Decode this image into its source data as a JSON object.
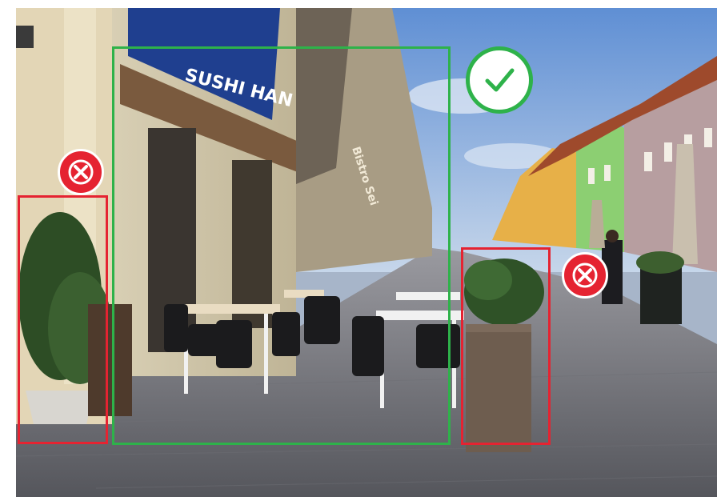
{
  "image": {
    "scene": "pedestrian cobblestone street with outdoor cafe terrace",
    "awning_text": "SUSHI HAN",
    "sign_text": "Bistro Sei"
  },
  "colors": {
    "accept": "#2eb24a",
    "reject": "#e52331",
    "sky": "#6f9bd8"
  },
  "annotations": [
    {
      "kind": "reject",
      "subject": "potted shrub",
      "icon": "cross-circle-icon"
    },
    {
      "kind": "accept",
      "subject": "cafe terrace with tables and chairs",
      "icon": "check-circle-icon"
    },
    {
      "kind": "reject",
      "subject": "concrete planter with shrub",
      "icon": "cross-circle-icon"
    }
  ]
}
